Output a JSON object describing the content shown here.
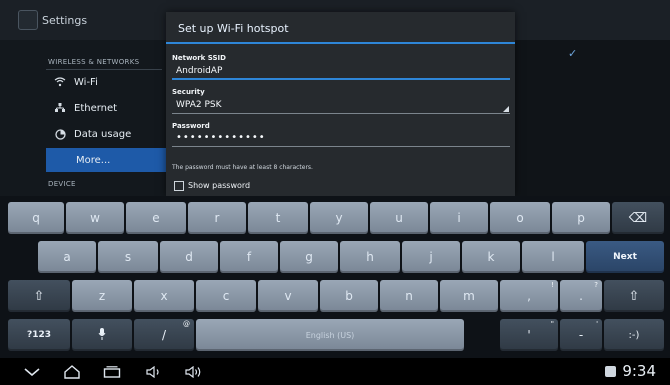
{
  "settings": {
    "app_title": "Settings",
    "section_wireless": "WIRELESS & NETWORKS",
    "section_device": "DEVICE",
    "items": [
      {
        "label": "Wi-Fi",
        "icon": "wifi-icon"
      },
      {
        "label": "Ethernet",
        "icon": "ethernet-icon"
      },
      {
        "label": "Data usage",
        "icon": "data-usage-icon"
      },
      {
        "label": "More...",
        "icon": ""
      }
    ]
  },
  "dialog": {
    "title": "Set up Wi-Fi hotspot",
    "ssid_label": "Network SSID",
    "ssid_value": "AndroidAP",
    "security_label": "Security",
    "security_value": "WPA2 PSK",
    "password_label": "Password",
    "password_value": "•••••••••••••",
    "hint": "The password must have at least 8 characters.",
    "show_password": "Show password"
  },
  "keyboard": {
    "row1": [
      "q",
      "w",
      "e",
      "r",
      "t",
      "y",
      "u",
      "i",
      "o",
      "p"
    ],
    "row2": [
      "a",
      "s",
      "d",
      "f",
      "g",
      "h",
      "j",
      "k",
      "l"
    ],
    "row3": [
      "z",
      "x",
      "c",
      "v",
      "b",
      "n",
      "m",
      ",",
      "."
    ],
    "row4_space": "English (US)",
    "next_label": "Next",
    "sym_label": "?123",
    "superscripts": {
      "comma": "!",
      "period": "?",
      "mic": "@",
      "c1": "'",
      "c2": "\""
    },
    "shift_symbol": "⇧",
    "backspace_symbol": "⌫",
    "smiley": ":-)"
  },
  "navbar": {
    "time": "9:34"
  }
}
